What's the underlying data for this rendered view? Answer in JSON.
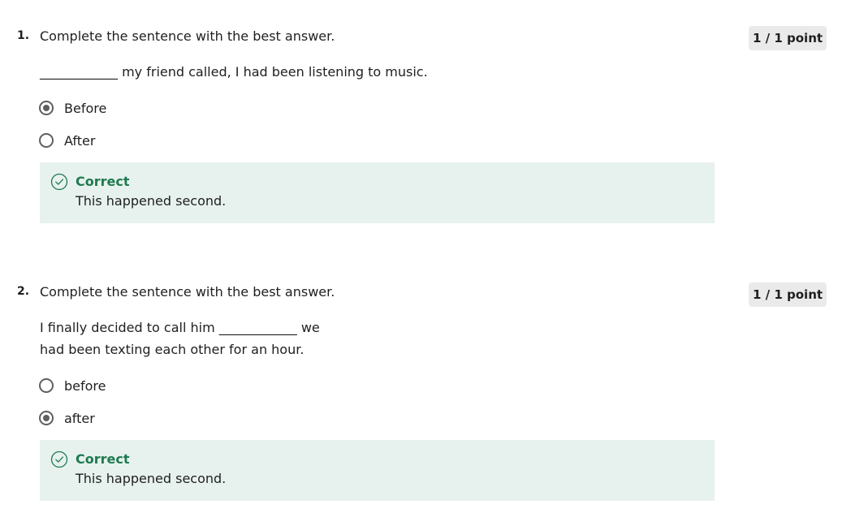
{
  "questions": [
    {
      "number": "1.",
      "prompt": "Complete the sentence with the best answer.",
      "points": "1 / 1 point",
      "sentence_lines": [
        "____________ my friend called, I had been listening to music."
      ],
      "options": [
        {
          "label": "Before",
          "selected": true
        },
        {
          "label": "After",
          "selected": false
        }
      ],
      "feedback": {
        "status": "Correct",
        "text": "This happened second.",
        "icon": "check-circle-icon"
      }
    },
    {
      "number": "2.",
      "prompt": "Complete the sentence with the best answer.",
      "points": "1 / 1 point",
      "sentence_lines": [
        "I finally decided to call him ____________ we",
        "had been texting each other for an hour."
      ],
      "options": [
        {
          "label": "before",
          "selected": false
        },
        {
          "label": "after",
          "selected": true
        }
      ],
      "feedback": {
        "status": "Correct",
        "text": "This happened second.",
        "icon": "check-circle-icon"
      }
    }
  ],
  "colors": {
    "feedback_background": "#e7f2ee",
    "correct_green": "#1f7a50",
    "points_badge": "#eaeaea",
    "radio": "#5f5f5f"
  }
}
